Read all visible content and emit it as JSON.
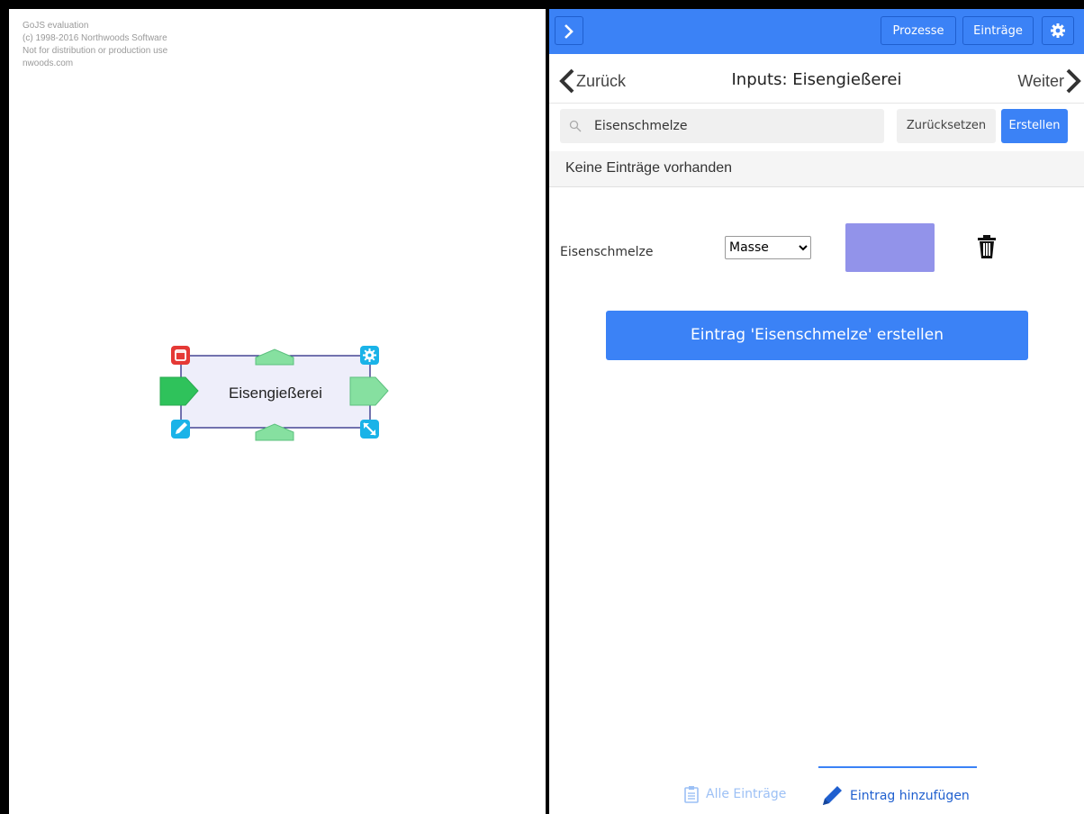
{
  "watermark": {
    "line1": "GoJS evaluation",
    "line2": "(c) 1998-2016 Northwoods Software",
    "line3": "Not for distribution or production use",
    "line4": "nwoods.com"
  },
  "diagram": {
    "node_label": "Eisengießerei",
    "icons": [
      "delete-icon",
      "settings-icon",
      "edit-icon",
      "resize-icon"
    ]
  },
  "topbar": {
    "toggle_icon": "chevron-right-icon",
    "prozesse_label": "Prozesse",
    "eintraege_label": "Einträge",
    "settings_icon": "gear-icon"
  },
  "nav": {
    "back_label": "Zurück",
    "title": "Inputs: Eisengießerei",
    "next_label": "Weiter"
  },
  "search": {
    "value": "Eisenschmelze",
    "reset_label": "Zurücksetzen",
    "create_label": "Erstellen"
  },
  "list": {
    "empty_text": "Keine Einträge vorhanden"
  },
  "entry": {
    "label": "Eisenschmelze",
    "unit_selected": "Masse",
    "color": "#9293ea"
  },
  "big_create_label": "Eintrag 'Eisenschmelze' erstellen",
  "tabs": {
    "all_label": "Alle Einträge",
    "add_label": "Eintrag hinzufügen"
  },
  "colors": {
    "accent": "#3b82f6",
    "port_green": "#86e0a0",
    "port_green_dark": "#2fc25b",
    "delete_red": "#e53935",
    "tool_blue": "#1ab3e8"
  }
}
